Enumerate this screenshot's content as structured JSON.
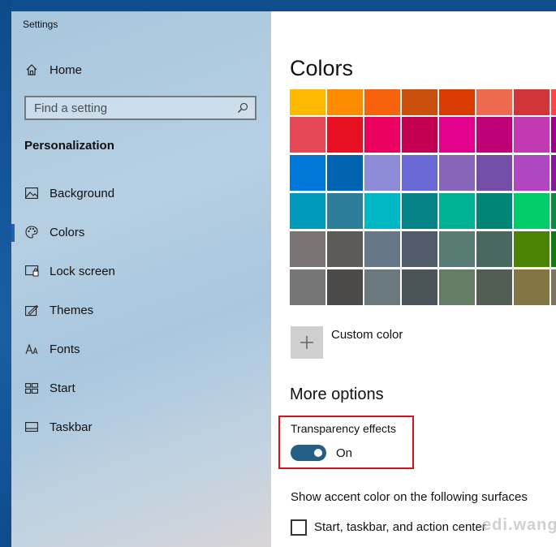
{
  "window": {
    "title": "Settings"
  },
  "sidebar": {
    "home_label": "Home",
    "search_placeholder": "Find a setting",
    "section_title": "Personalization",
    "items": [
      {
        "label": "Background",
        "icon": "image-icon"
      },
      {
        "label": "Colors",
        "icon": "palette-icon",
        "active": true
      },
      {
        "label": "Lock screen",
        "icon": "lock-screen-icon"
      },
      {
        "label": "Themes",
        "icon": "themes-icon"
      },
      {
        "label": "Fonts",
        "icon": "fonts-icon"
      },
      {
        "label": "Start",
        "icon": "start-icon"
      },
      {
        "label": "Taskbar",
        "icon": "taskbar-icon"
      }
    ]
  },
  "main": {
    "title": "Colors",
    "swatch_rows": [
      [
        "#FFB900",
        "#FF8C00",
        "#F7630C",
        "#CA5010",
        "#DA3B01",
        "#EF6950",
        "#D13438",
        "#FF4343"
      ],
      [
        "#E74856",
        "#E81123",
        "#EA005E",
        "#C30052",
        "#E3008C",
        "#BF0077",
        "#C239B3",
        "#9A0089"
      ],
      [
        "#0078D7",
        "#0063B1",
        "#8E8CD8",
        "#6B69D6",
        "#8764B8",
        "#744DA9",
        "#B146C2",
        "#881798"
      ],
      [
        "#0099BC",
        "#2D7D9A",
        "#00B7C3",
        "#038387",
        "#00B294",
        "#018574",
        "#00CC6A",
        "#10893E"
      ],
      [
        "#7A7574",
        "#5D5A58",
        "#68768A",
        "#515C6B",
        "#567C73",
        "#486860",
        "#498205",
        "#107C10"
      ],
      [
        "#767676",
        "#4C4A48",
        "#69797E",
        "#4A5459",
        "#647C64",
        "#525E54",
        "#847545",
        "#7E735F"
      ]
    ],
    "custom_color_label": "Custom color",
    "more_options_title": "More options",
    "transparency_label": "Transparency effects",
    "transparency_state": "On",
    "accent_surfaces_label": "Show accent color on the following surfaces",
    "checkbox_label": "Start, taskbar, and action center",
    "watermark": "edi.wang"
  }
}
